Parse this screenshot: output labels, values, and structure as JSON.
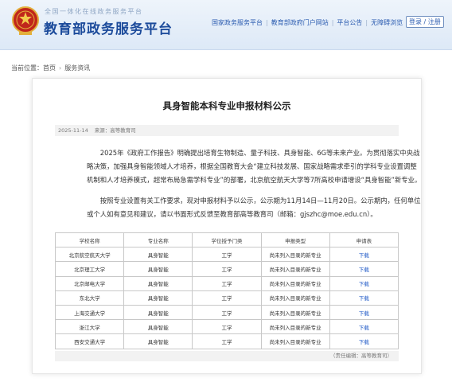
{
  "header": {
    "site_subtitle": "全国一体化在线政务服务平台",
    "site_title": "教育部政务服务平台",
    "links": [
      "国家政务服务平台",
      "教育部政府门户网站",
      "平台公告",
      "无障碍浏览"
    ],
    "login_label": "登录 / 注册",
    "colors": {
      "brand": "#1c4b9b",
      "link": "#2a5bb0",
      "emblem": "#c0261b"
    }
  },
  "breadcrumb": {
    "prefix": "当前位置：",
    "home": "首页",
    "current": "服务资讯"
  },
  "article": {
    "title": "具身智能本科专业申报材料公示",
    "date": "2025-11-14",
    "source": "来源：高等教育司",
    "para1_lines": [
      "2025年《政府工作报告》明确提出培育生物制造、量子科技、具身智能、6G等未来产业。为贯彻落实中央战",
      "略决策，加强具身智能领域人才培养，根据全国教育大会“建立科技发展、国家战略需求牵引的学科专业设置调整",
      "机制和人才培养模式，超常布局急需学科专业”的部署，北京航空航天大学等7所高校申请增设“具身智能”新专业。"
    ],
    "para2_lines": [
      "按照专业设置有关工作要求，现对申报材料予以公示，公示期为11月14日—11月20日。公示期内，任何单位",
      "或个人如有意见和建议，请以书面形式反馈至教育部高等教育司（邮箱：gjszhc@moe.edu.cn）。"
    ],
    "table": {
      "headers": [
        "学校名称",
        "专业名称",
        "学位授予门类",
        "申报类型",
        "申请表"
      ],
      "rows": [
        [
          "北京航空航天大学",
          "具身智能",
          "工学",
          "尚未列入目录的新专业",
          "下载"
        ],
        [
          "北京理工大学",
          "具身智能",
          "工学",
          "尚未列入目录的新专业",
          "下载"
        ],
        [
          "北京邮电大学",
          "具身智能",
          "工学",
          "尚未列入目录的新专业",
          "下载"
        ],
        [
          "东北大学",
          "具身智能",
          "工学",
          "尚未列入目录的新专业",
          "下载"
        ],
        [
          "上海交通大学",
          "具身智能",
          "工学",
          "尚未列入目录的新专业",
          "下载"
        ],
        [
          "浙江大学",
          "具身智能",
          "工学",
          "尚未列入目录的新专业",
          "下载"
        ],
        [
          "西安交通大学",
          "具身智能",
          "工学",
          "尚未列入目录的新专业",
          "下载"
        ]
      ]
    },
    "editor": "（责任编辑：高等教育司）"
  }
}
